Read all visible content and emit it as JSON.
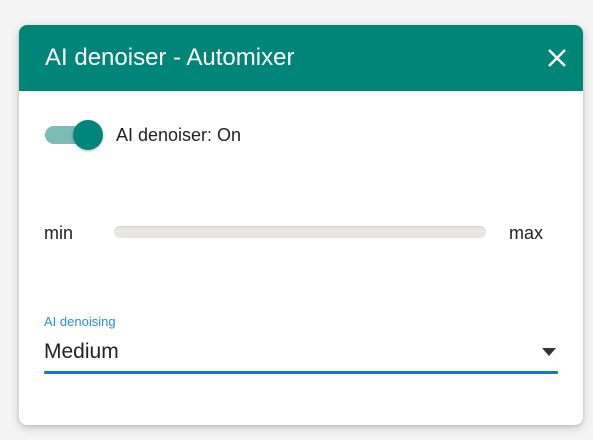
{
  "dialog": {
    "title": "AI denoiser - Automixer",
    "header_color": "#008577",
    "close_icon": "close-icon"
  },
  "toggle": {
    "label": "AI denoiser: On",
    "state": true,
    "accent": "#00857a"
  },
  "slider": {
    "min_label": "min",
    "max_label": "max",
    "value_fraction": 0
  },
  "select": {
    "label": "AI denoising",
    "value": "Medium",
    "accent": "#1877c9",
    "caret_icon": "caret-down-icon"
  }
}
